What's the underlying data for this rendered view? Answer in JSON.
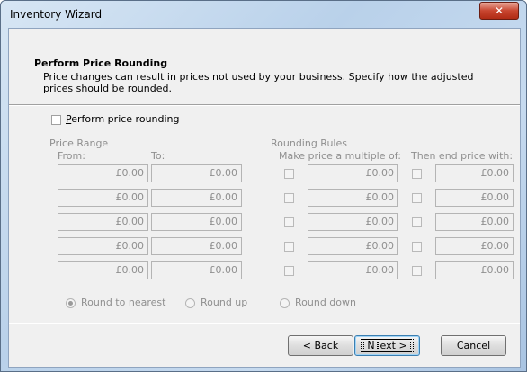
{
  "window": {
    "title": "Inventory Wizard",
    "close_glyph": "✕"
  },
  "header": {
    "title": "Perform Price Rounding",
    "description": "Price changes can result in prices not used by your business.  Specify how the adjusted prices should be rounded."
  },
  "perform_rounding": {
    "label_first": "P",
    "label_rest": "erform price rounding",
    "checked": false
  },
  "price_range": {
    "group_label": "Price Range",
    "from_label": "From:",
    "to_label": "To:"
  },
  "rounding_rules": {
    "group_label": "Rounding Rules",
    "multiple_label": "Make price a multiple of:",
    "end_label": "Then end price with:"
  },
  "rows": [
    {
      "from": "£0.00",
      "to": "£0.00",
      "multiple": "£0.00",
      "end": "£0.00"
    },
    {
      "from": "£0.00",
      "to": "£0.00",
      "multiple": "£0.00",
      "end": "£0.00"
    },
    {
      "from": "£0.00",
      "to": "£0.00",
      "multiple": "£0.00",
      "end": "£0.00"
    },
    {
      "from": "£0.00",
      "to": "£0.00",
      "multiple": "£0.00",
      "end": "£0.00"
    },
    {
      "from": "£0.00",
      "to": "£0.00",
      "multiple": "£0.00",
      "end": "£0.00"
    }
  ],
  "round_options": {
    "nearest": "Round to nearest",
    "up": "Round up",
    "down": "Round down",
    "selected": "nearest"
  },
  "buttons": {
    "back_pre": "< Bac",
    "back_key": "k",
    "next_key": "N",
    "next_post": "ext >",
    "cancel": "Cancel"
  }
}
